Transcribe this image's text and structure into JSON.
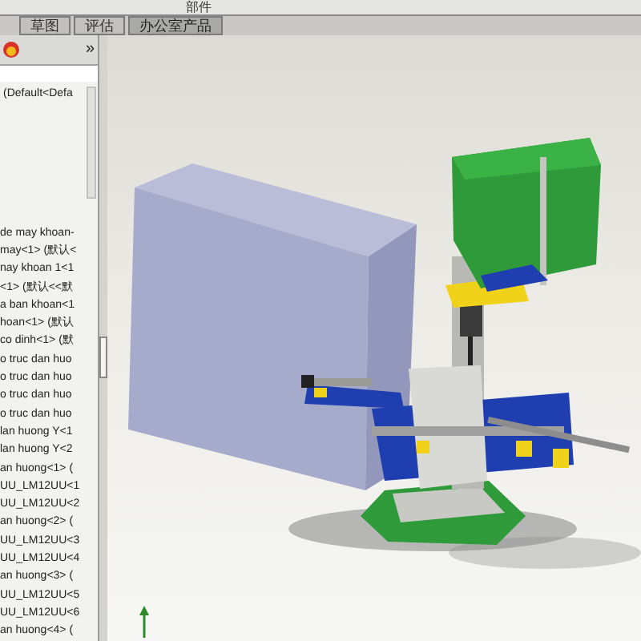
{
  "toolbar": {
    "label": "部件"
  },
  "tabs": [
    {
      "label": "草图",
      "selected": false
    },
    {
      "label": "评估",
      "selected": false
    },
    {
      "label": "办公室产品",
      "selected": true
    }
  ],
  "panel": {
    "expand": "»",
    "config": "(Default<Defa",
    "items": [
      "de may khoan-",
      "may<1> (默认<",
      "nay khoan 1<1",
      "<1> (默认<<默",
      "a ban khoan<1",
      "hoan<1> (默认",
      "co dinh<1> (默",
      "o truc dan huo",
      "o truc dan huo",
      "o truc dan huo",
      "o truc dan huo",
      "lan huong Y<1",
      "lan huong Y<2",
      "an huong<1> (",
      "UU_LM12UU<1",
      "UU_LM12UU<2",
      "an huong<2> (",
      "UU_LM12UU<3",
      "UU_LM12UU<4",
      "an huong<3> (",
      "UU_LM12UU<5",
      "UU_LM12UU<6",
      "an huong<4> ("
    ]
  }
}
